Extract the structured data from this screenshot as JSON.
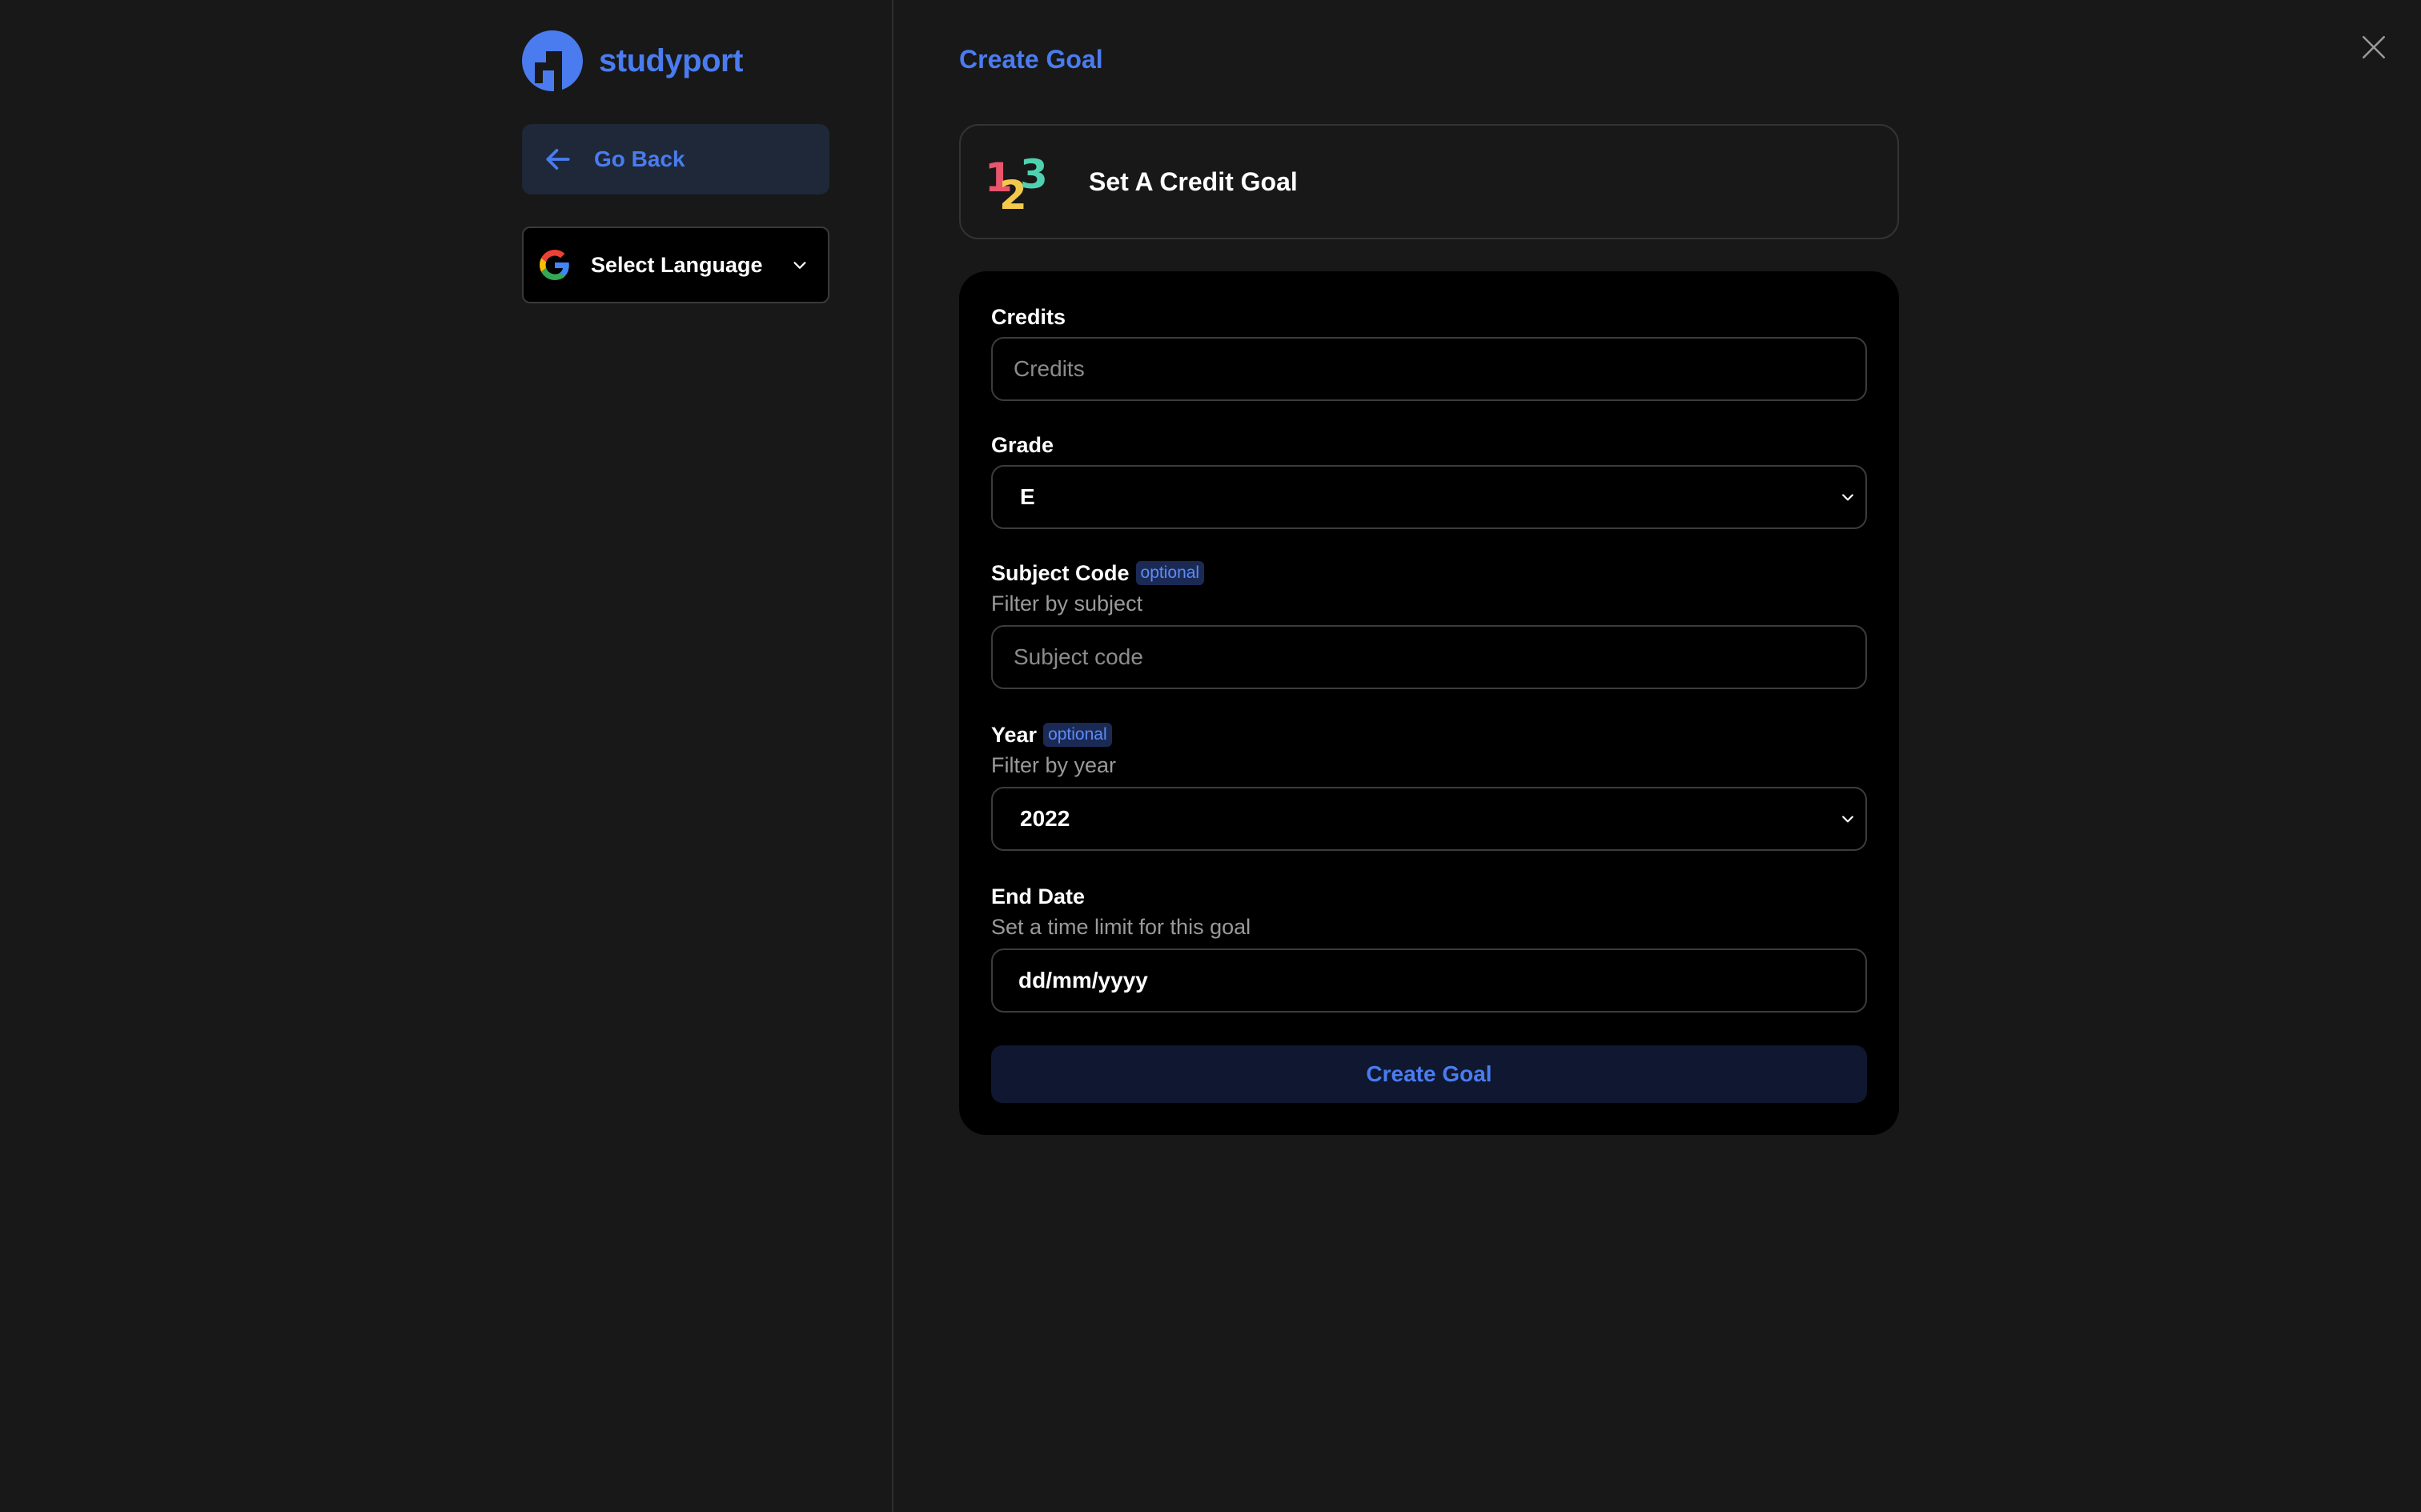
{
  "brand": {
    "name": "studyport",
    "accent": "#4a7cf0"
  },
  "sidebar": {
    "go_back_label": "Go Back",
    "language_select_label": "Select Language"
  },
  "header": {
    "title": "Create Goal"
  },
  "goal_card": {
    "title": "Set A Credit Goal",
    "icon": "numbers-123-icon"
  },
  "form": {
    "credits": {
      "label": "Credits",
      "placeholder": "Credits",
      "value": ""
    },
    "grade": {
      "label": "Grade",
      "selected": "E"
    },
    "subject_code": {
      "label": "Subject Code",
      "badge": "optional",
      "description": "Filter by subject",
      "placeholder": "Subject code",
      "value": ""
    },
    "year": {
      "label": "Year",
      "badge": "optional",
      "description": "Filter by year",
      "selected": "2022"
    },
    "end_date": {
      "label": "End Date",
      "description": "Set a time limit for this goal",
      "value": "dd/mm/yyyy"
    },
    "submit_label": "Create Goal"
  },
  "colors": {
    "background": "#181818",
    "form_background": "#000000",
    "accent": "#4a7cf0",
    "go_back_background": "#1e2838",
    "submit_background": "#0f1830",
    "badge_background": "#1b2a55"
  }
}
